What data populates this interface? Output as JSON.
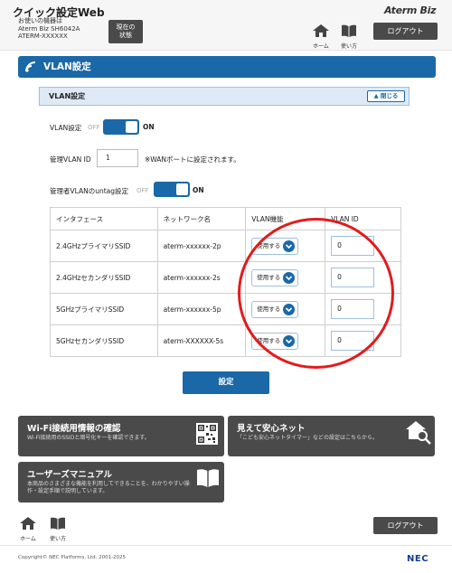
{
  "header": {
    "app_title": "クイック設定Web",
    "device_line1": "お使いの機器は",
    "device_line2": "Aterm Biz SH6042A",
    "device_line3": "ATERM-XXXXXX",
    "status_button": "現在の\n状態",
    "brand": "Aterm Biz",
    "home_label": "ホーム",
    "manual_label": "使い方",
    "logout_label": "ログアウト"
  },
  "page": {
    "title": "VLAN設定",
    "section_title": "VLAN設定",
    "close_label": "閉じる"
  },
  "form": {
    "vlan_setting_label": "VLAN設定",
    "vlan_setting_off": "OFF",
    "vlan_setting_on": "ON",
    "mgmt_vlan_label": "管理VLAN ID",
    "mgmt_vlan_value": "1",
    "mgmt_vlan_note": "※WANポートに設定されます。",
    "untag_label": "管理者VLANのuntag設定",
    "untag_off": "OFF",
    "untag_on": "ON"
  },
  "table": {
    "headers": [
      "インタフェース",
      "ネットワーク名",
      "VLAN機能",
      "VLAN ID"
    ],
    "rows": [
      {
        "interface": "2.4GHzプライマリSSID",
        "network": "aterm-xxxxxx-2p",
        "func": "使用する",
        "vlan_id": "0"
      },
      {
        "interface": "2.4GHzセカンダリSSID",
        "network": "aterm-xxxxxx-2s",
        "func": "使用する",
        "vlan_id": "0"
      },
      {
        "interface": "5GHzプライマリSSID",
        "network": "aterm-xxxxxx-5p",
        "func": "使用する",
        "vlan_id": "0"
      },
      {
        "interface": "5GHzセカンダリSSID",
        "network": "aterm-XXXXXX-5s",
        "func": "使用する",
        "vlan_id": "0"
      }
    ]
  },
  "set_button": "設定",
  "cards": {
    "wifi_title": "Wi-Fi接続用情報の確認",
    "wifi_desc": "Wi-Fi接続用のSSIDと暗号化キーを確認できます。",
    "safety_title": "見えて安心ネット",
    "safety_desc": "「こども安心ネットタイマー」などの設定はこちらから。",
    "manual_title": "ユーザーズマニュアル",
    "manual_desc1": "本商品のさまざまな機能を利用してできることを、わかりやすい操",
    "manual_desc2": "作・設定手順で説明しています。"
  },
  "footer": {
    "home_label": "ホーム",
    "manual_label": "使い方",
    "logout_label": "ログアウト",
    "copyright": "Copyright© NEC Platforms, Ltd. 2001-2025",
    "nec": "NEC"
  },
  "colors": {
    "accent": "#1a68a8",
    "dark_button": "#4a4a4a",
    "highlight": "#e31b1b"
  }
}
